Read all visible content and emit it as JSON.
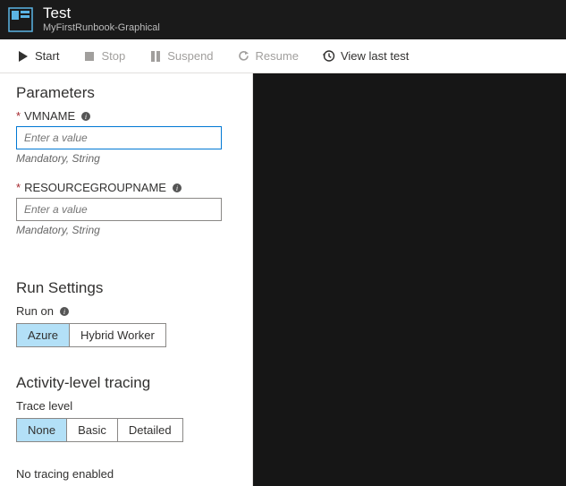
{
  "header": {
    "title": "Test",
    "subtitle": "MyFirstRunbook-Graphical"
  },
  "toolbar": {
    "start": "Start",
    "stop": "Stop",
    "suspend": "Suspend",
    "resume": "Resume",
    "viewLastTest": "View last test"
  },
  "parameters": {
    "heading": "Parameters",
    "items": [
      {
        "name": "VMNAME",
        "placeholder": "Enter a value",
        "hint": "Mandatory, String",
        "required": true,
        "focused": true
      },
      {
        "name": "RESOURCEGROUPNAME",
        "placeholder": "Enter a value",
        "hint": "Mandatory, String",
        "required": true,
        "focused": false
      }
    ]
  },
  "runSettings": {
    "heading": "Run Settings",
    "label": "Run on",
    "options": [
      "Azure",
      "Hybrid Worker"
    ],
    "selected": "Azure"
  },
  "tracing": {
    "heading": "Activity-level tracing",
    "label": "Trace level",
    "options": [
      "None",
      "Basic",
      "Detailed"
    ],
    "selected": "None",
    "status": "No tracing enabled"
  }
}
